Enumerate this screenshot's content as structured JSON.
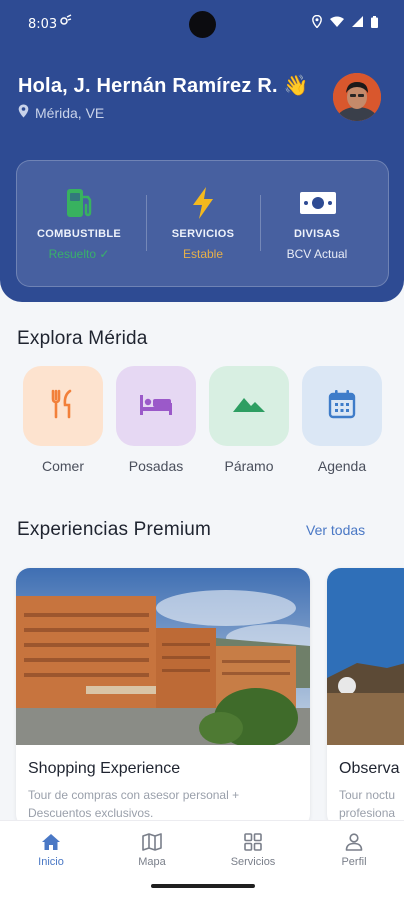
{
  "status_bar": {
    "time": "8:03"
  },
  "header": {
    "greeting": "Hola, J. Hernán Ramírez R. 👋",
    "location": "Mérida, VE"
  },
  "status_card": [
    {
      "id": "combustible",
      "label": "COMBUSTIBLE",
      "value": "Resuelto ✓",
      "value_color": "#39b06b",
      "icon": "gas-pump-icon"
    },
    {
      "id": "servicios",
      "label": "SERVICIOS",
      "value": "Estable",
      "value_color": "#e6b04a",
      "icon": "lightning-icon"
    },
    {
      "id": "divisas",
      "label": "DIVISAS",
      "value": "BCV Actual",
      "value_color": "#e8ecf6",
      "icon": "money-icon"
    }
  ],
  "explore": {
    "title": "Explora Mérida",
    "items": [
      {
        "label": "Comer",
        "icon": "utensils-icon",
        "bg": "#fde3cf",
        "color": "#f2803a"
      },
      {
        "label": "Posadas",
        "icon": "bed-icon",
        "bg": "#e6d8f3",
        "color": "#9b59c9"
      },
      {
        "label": "Páramo",
        "icon": "mountain-icon",
        "bg": "#d8efe2",
        "color": "#2e9e62"
      },
      {
        "label": "Agenda",
        "icon": "calendar-icon",
        "bg": "#dbe7f5",
        "color": "#3e7cc9"
      }
    ]
  },
  "premium": {
    "title": "Experiencias Premium",
    "see_all": "Ver todas",
    "cards": [
      {
        "title": "Shopping Experience",
        "description": "Tour de compras con asesor personal + Descuentos exclusivos."
      },
      {
        "title": "Observa",
        "description": "Tour noctu profesiona"
      }
    ]
  },
  "bottom_nav": [
    {
      "label": "Inicio",
      "icon": "home-icon",
      "active": true
    },
    {
      "label": "Mapa",
      "icon": "map-icon",
      "active": false
    },
    {
      "label": "Servicios",
      "icon": "grid-icon",
      "active": false
    },
    {
      "label": "Perfil",
      "icon": "user-icon",
      "active": false
    }
  ],
  "colors": {
    "primary": "#2e4b93",
    "accent": "#4a78c5",
    "background": "#f4f6f9"
  }
}
